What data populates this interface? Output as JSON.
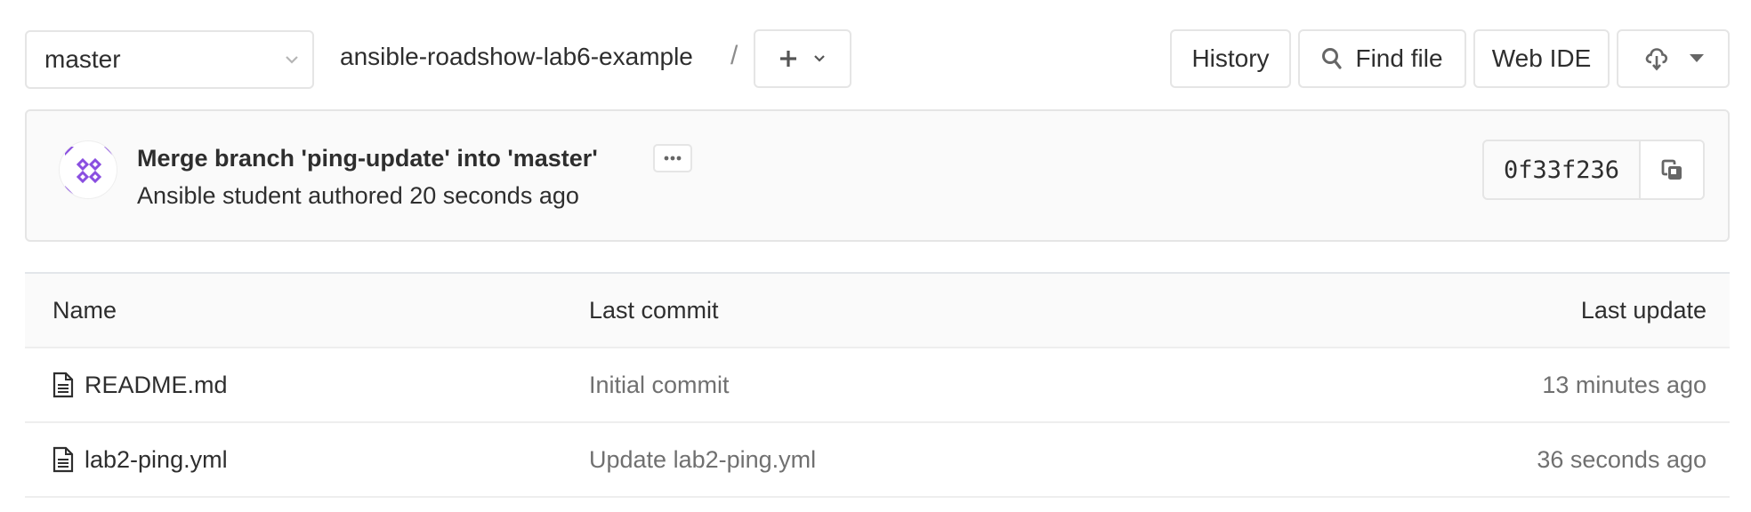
{
  "toolbar": {
    "branch": "master",
    "project": "ansible-roadshow-lab6-example",
    "separator": "/",
    "add_label": "+",
    "history_label": "History",
    "find_file_label": "Find file",
    "web_ide_label": "Web IDE"
  },
  "commit": {
    "title": "Merge branch 'ping-update' into 'master'",
    "author_line": "Ansible student authored 20 seconds ago",
    "more_label": "•••",
    "sha": "0f33f236",
    "avatar_color": "#8a4fe0"
  },
  "table": {
    "headers": {
      "name": "Name",
      "last_commit": "Last commit",
      "last_update": "Last update"
    },
    "rows": [
      {
        "name": "README.md",
        "last_commit": "Initial commit",
        "last_update": "13 minutes ago",
        "icon": "file-text-icon"
      },
      {
        "name": "lab2-ping.yml",
        "last_commit": "Update lab2-ping.yml",
        "last_update": "36 seconds ago",
        "icon": "file-text-icon"
      }
    ]
  }
}
